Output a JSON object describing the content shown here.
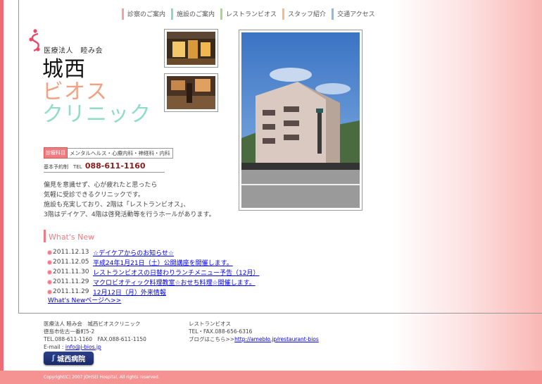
{
  "nav": {
    "items": [
      {
        "label": "診察のご案内",
        "color": "#f5a0a8"
      },
      {
        "label": "施設のご案内",
        "color": "#8fd6c4"
      },
      {
        "label": "レストランビオス",
        "color": "#a8d88c"
      },
      {
        "label": "スタッフ紹介",
        "color": "#f5b98a"
      },
      {
        "label": "交通アクセス",
        "color": "#8fb8e0"
      }
    ]
  },
  "logo": {
    "corp": "医療法人　睦み会",
    "title1": "城西",
    "title2": "ビオス",
    "title3": "クリニック"
  },
  "dept": {
    "label": "診療科目",
    "value": "メンタルヘルス・心療内科・神経科・内科"
  },
  "tel": {
    "label": "基本予約制　TEL",
    "number": "088-611-1160"
  },
  "intro": [
    "偏見を意識せず、心が疲れたと思ったら",
    "気軽に受診できるクリニックです。",
    "施設も充実しており、2階は「レストランビオス」、",
    "3階はデイケア、4階は啓発活動等を行うホールがあります。"
  ],
  "news": {
    "title": "What's New",
    "items": [
      {
        "date": "2011.12.13",
        "text": "☆デイケアからのお知らせ☆"
      },
      {
        "date": "2011.12.05",
        "text": "平成24年1月21日（土）公開講座を開催します。"
      },
      {
        "date": "2011.11.30",
        "text": "レストランビオスの日替わりランチメニュー予告（12月）"
      },
      {
        "date": "2011.11.29",
        "text": "マクロビオティック料理教室☆おせち料理☆開催します。"
      },
      {
        "date": "2011.11.29",
        "text": "12月12日（月）外来情報"
      }
    ],
    "more": "What's Newページへ>>"
  },
  "footer": {
    "left": {
      "line1": "医療法人 睦み会　城西ビオスクリニック",
      "line2": "徳島市佐古一番町5-2",
      "line3": "TEL.088-611-1160　FAX.088-611-1150",
      "email_label": "E-mail : ",
      "email": "info@j-bios.jp"
    },
    "right": {
      "line1": "レストランビオス",
      "line2": "TEL・FAX.088-656-6316",
      "blog_label": "ブログはこちら>>",
      "blog_url": "http://ameblo.jp/restaurant-bios"
    },
    "hospital_button": "城西病院",
    "copyright": "Copyright(C) 2007 JOHSEI Hospital, All rights reserved."
  }
}
